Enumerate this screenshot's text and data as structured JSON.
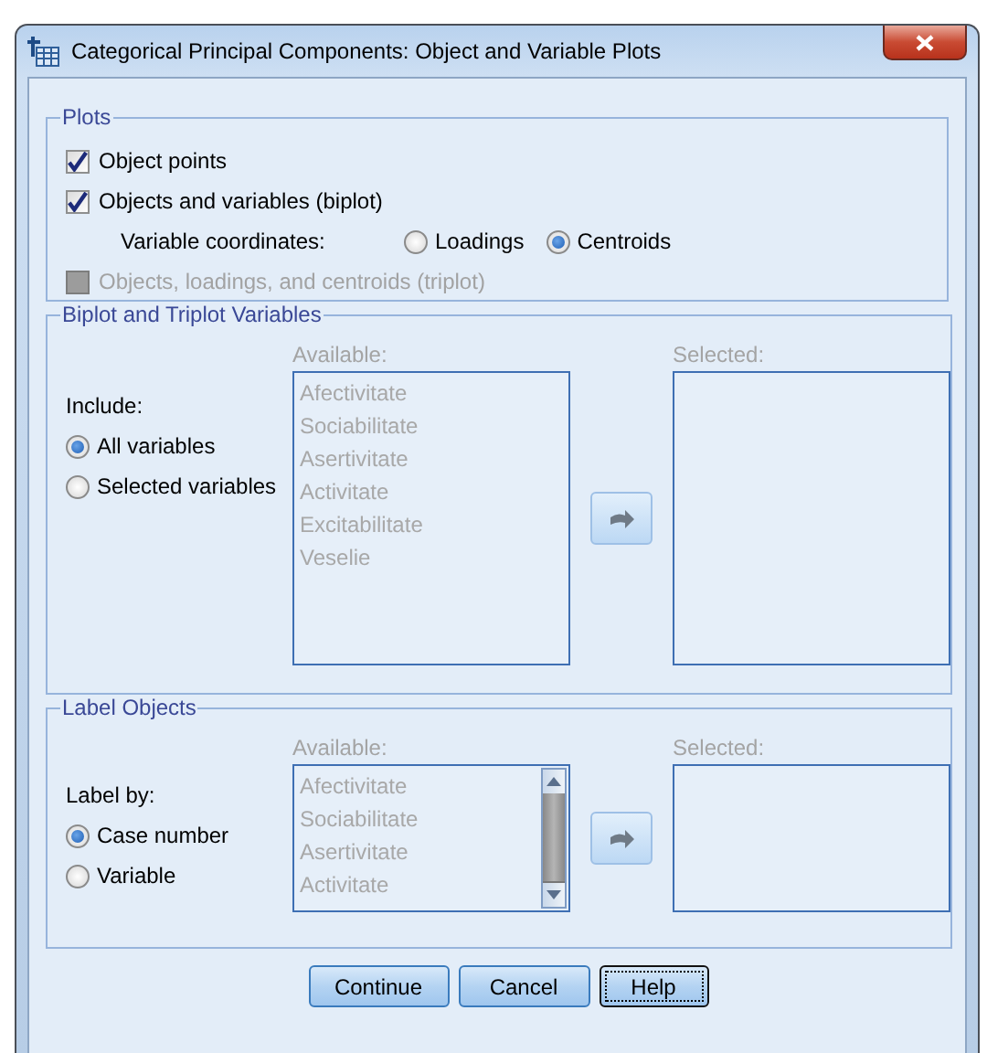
{
  "window": {
    "title": "Categorical Principal Components: Object and Variable Plots"
  },
  "plots": {
    "legend": "Plots",
    "rows": [
      {
        "kind": "checkbox",
        "label": "Object points",
        "checked": true,
        "disabled": false
      },
      {
        "kind": "checkbox",
        "label": "Objects and variables (biplot)",
        "checked": true,
        "disabled": false
      },
      {
        "kind": "radio-group",
        "label": "Variable coordinates:",
        "options": [
          {
            "label": "Loadings",
            "selected": false
          },
          {
            "label": "Centroids",
            "selected": true
          }
        ]
      },
      {
        "kind": "checkbox",
        "label": "Objects, loadings, and centroids (triplot)",
        "checked": false,
        "disabled": true
      }
    ]
  },
  "biplot_variables": {
    "legend": "Biplot and Triplot Variables",
    "prompt": "Include:",
    "choices": [
      {
        "label": "All variables",
        "selected": true
      },
      {
        "label": "Selected variables",
        "selected": false
      }
    ],
    "available": {
      "label": "Available:",
      "disabled": true,
      "items": [
        "Afectivitate",
        "Sociabilitate",
        "Asertivitate",
        "Activitate",
        "Excitabilitate",
        "Veselie"
      ]
    },
    "move_button": {
      "disabled": true
    },
    "selected_list": {
      "label": "Selected:",
      "disabled": true
    }
  },
  "label_objects": {
    "legend": "Label Objects",
    "prompt": "Label by:",
    "choices": [
      {
        "label": "Case number",
        "selected": true
      },
      {
        "label": "Variable",
        "selected": false
      }
    ],
    "available": {
      "label": "Available:",
      "disabled": true,
      "items": [
        "Afectivitate",
        "Sociabilitate",
        "Asertivitate",
        "Activitate"
      ]
    },
    "move_button": {
      "disabled": true
    },
    "selected_list": {
      "label": "Selected:",
      "disabled": true
    }
  },
  "buttons": [
    {
      "label": "Continue",
      "focused": false
    },
    {
      "label": "Cancel",
      "focused": false
    },
    {
      "label": "Help",
      "focused": true
    }
  ]
}
